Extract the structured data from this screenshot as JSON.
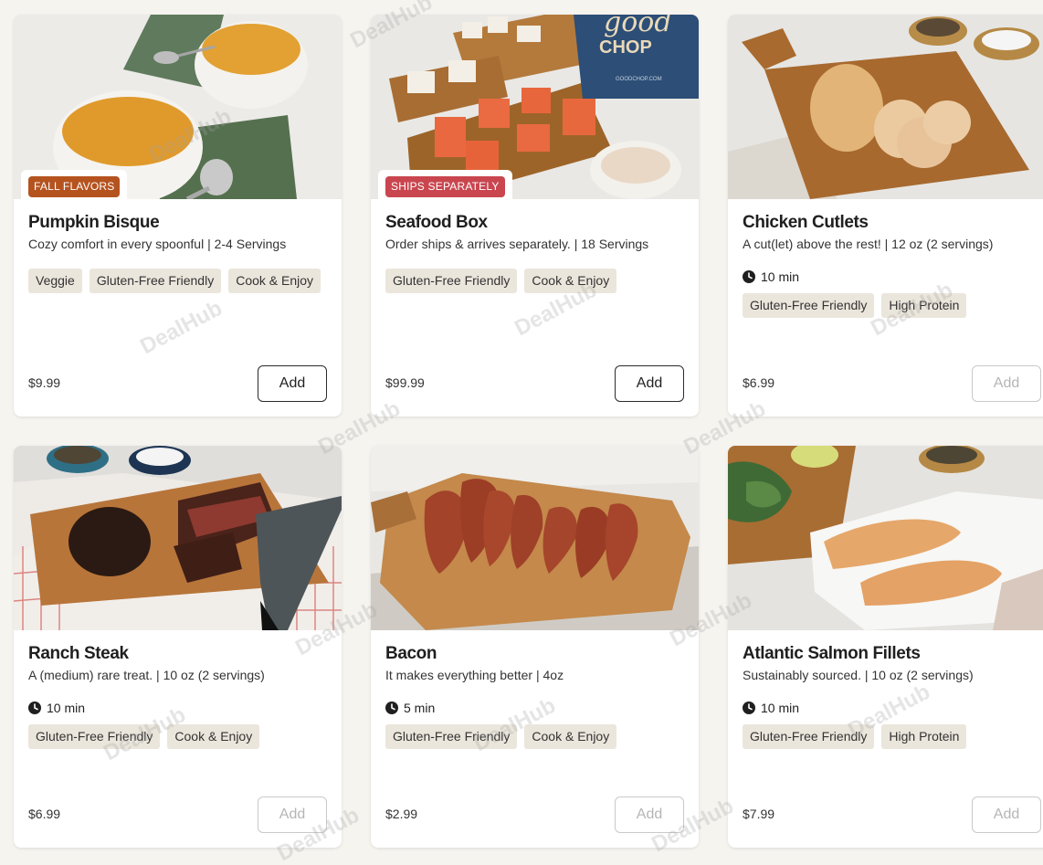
{
  "products": [
    {
      "title": "Pumpkin Bisque",
      "description": "Cozy comfort in every spoonful | 2-4 Servings",
      "promo": "FALL FLAVORS",
      "promo_color": "#b5531f",
      "time": "",
      "tags": [
        "Veggie",
        "Gluten-Free Friendly",
        "Cook & Enjoy"
      ],
      "price": "$9.99",
      "add_label": "Add",
      "add_enabled": true
    },
    {
      "title": "Seafood Box",
      "description": "Order ships & arrives separately. | 18 Servings",
      "promo": "SHIPS SEPARATELY",
      "promo_color": "#c9464f",
      "time": "",
      "tags": [
        "Gluten-Free Friendly",
        "Cook & Enjoy"
      ],
      "price": "$99.99",
      "add_label": "Add",
      "add_enabled": true
    },
    {
      "title": "Chicken Cutlets",
      "description": "A cut(let) above the rest! | 12 oz (2 servings)",
      "promo": "",
      "time": "10 min",
      "tags": [
        "Gluten-Free Friendly",
        "High Protein"
      ],
      "price": "$6.99",
      "add_label": "Add",
      "add_enabled": false
    },
    {
      "title": "Ranch Steak",
      "description": "A (medium) rare treat. | 10 oz (2 servings)",
      "promo": "",
      "time": "10 min",
      "tags": [
        "Gluten-Free Friendly",
        "Cook & Enjoy"
      ],
      "price": "$6.99",
      "add_label": "Add",
      "add_enabled": false
    },
    {
      "title": "Bacon",
      "description": "It makes everything better | 4oz",
      "promo": "",
      "time": "5 min",
      "tags": [
        "Gluten-Free Friendly",
        "Cook & Enjoy"
      ],
      "price": "$2.99",
      "add_label": "Add",
      "add_enabled": false
    },
    {
      "title": "Atlantic Salmon Fillets",
      "description": "Sustainably sourced. | 10 oz (2 servings)",
      "promo": "",
      "time": "10 min",
      "tags": [
        "Gluten-Free Friendly",
        "High Protein"
      ],
      "price": "$7.99",
      "add_label": "Add",
      "add_enabled": false
    }
  ],
  "photo_box_text": {
    "brand_line1": "good",
    "brand_line2": "CHOP",
    "site": "GOODCHOP.COM"
  },
  "watermark": "DealHub",
  "colors": {
    "page_bg": "#f6f4ef",
    "tag_bg": "#ebe6dc",
    "button_border": "#2b2b2b",
    "disabled_border": "#c9c9c9"
  }
}
